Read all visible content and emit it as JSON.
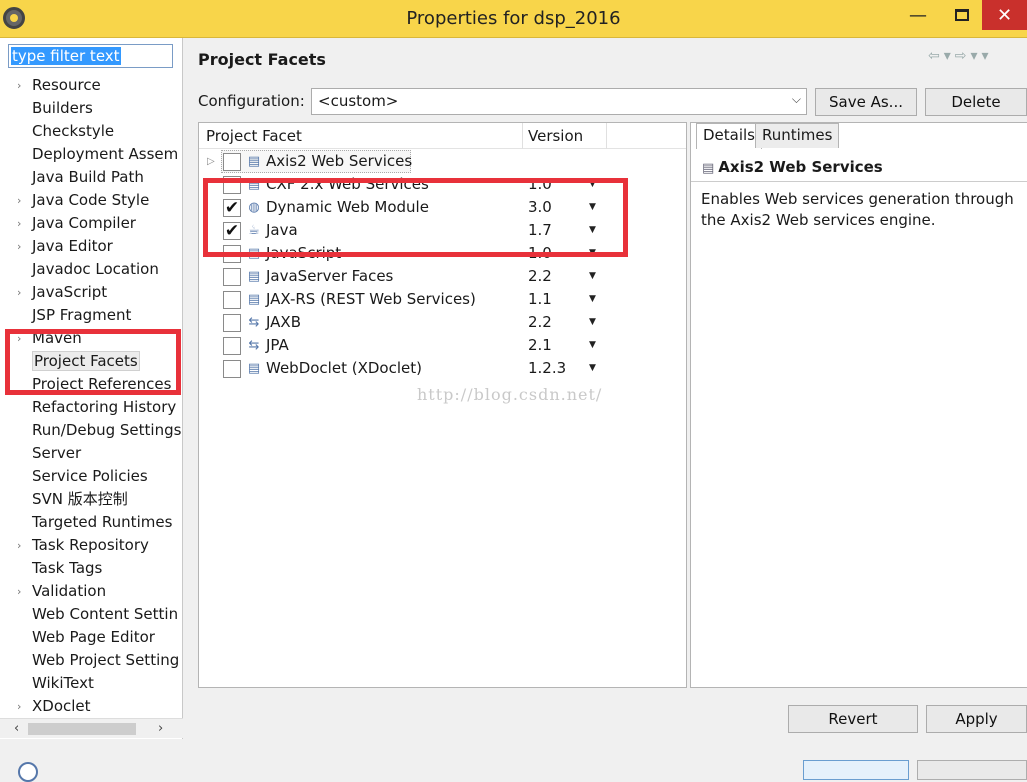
{
  "window": {
    "title": "Properties for dsp_2016"
  },
  "filter": {
    "value": "type filter text"
  },
  "nav_items": [
    {
      "label": "Resource",
      "expandable": true
    },
    {
      "label": "Builders",
      "expandable": false
    },
    {
      "label": "Checkstyle",
      "expandable": false
    },
    {
      "label": "Deployment Assem",
      "expandable": false
    },
    {
      "label": "Java Build Path",
      "expandable": false
    },
    {
      "label": "Java Code Style",
      "expandable": true
    },
    {
      "label": "Java Compiler",
      "expandable": true
    },
    {
      "label": "Java Editor",
      "expandable": true
    },
    {
      "label": "Javadoc Location",
      "expandable": false
    },
    {
      "label": "JavaScript",
      "expandable": true
    },
    {
      "label": "JSP Fragment",
      "expandable": false
    },
    {
      "label": "Maven",
      "expandable": true
    },
    {
      "label": "Project Facets",
      "expandable": false,
      "selected": true
    },
    {
      "label": "Project References",
      "expandable": false
    },
    {
      "label": "Refactoring History",
      "expandable": false
    },
    {
      "label": "Run/Debug Settings",
      "expandable": false
    },
    {
      "label": "Server",
      "expandable": false
    },
    {
      "label": "Service Policies",
      "expandable": false
    },
    {
      "label": "SVN 版本控制",
      "expandable": false
    },
    {
      "label": "Targeted Runtimes",
      "expandable": false
    },
    {
      "label": "Task Repository",
      "expandable": true
    },
    {
      "label": "Task Tags",
      "expandable": false
    },
    {
      "label": "Validation",
      "expandable": true
    },
    {
      "label": "Web Content Settin",
      "expandable": false
    },
    {
      "label": "Web Page Editor",
      "expandable": false
    },
    {
      "label": "Web Project Setting",
      "expandable": false
    },
    {
      "label": "WikiText",
      "expandable": false
    },
    {
      "label": "XDoclet",
      "expandable": true
    }
  ],
  "page": {
    "title": "Project Facets"
  },
  "config": {
    "label": "Configuration:",
    "value": "<custom>",
    "save_as": "Save As...",
    "delete": "Delete"
  },
  "facet_table": {
    "col_facet": "Project Facet",
    "col_version": "Version",
    "rows": [
      {
        "name": "Axis2 Web Services",
        "version": "",
        "checked": false,
        "expandable": true,
        "icon": "doc-icon",
        "highlighted": true
      },
      {
        "name": "CXF 2.x Web Services",
        "version": "1.0",
        "checked": false,
        "icon": "doc-icon"
      },
      {
        "name": "Dynamic Web Module",
        "version": "3.0",
        "checked": true,
        "icon": "web-module-icon"
      },
      {
        "name": "Java",
        "version": "1.7",
        "checked": true,
        "icon": "java-icon"
      },
      {
        "name": "JavaScript",
        "version": "1.0",
        "checked": false,
        "icon": "doc-icon"
      },
      {
        "name": "JavaServer Faces",
        "version": "2.2",
        "checked": false,
        "icon": "doc-icon"
      },
      {
        "name": "JAX-RS (REST Web Services)",
        "version": "1.1",
        "checked": false,
        "icon": "doc-icon"
      },
      {
        "name": "JAXB",
        "version": "2.2",
        "checked": false,
        "icon": "arrows-icon"
      },
      {
        "name": "JPA",
        "version": "2.1",
        "checked": false,
        "icon": "arrows-icon"
      },
      {
        "name": "WebDoclet (XDoclet)",
        "version": "1.2.3",
        "checked": false,
        "icon": "doc-icon"
      }
    ]
  },
  "watermark": "http://blog.csdn.net/",
  "details": {
    "tab_details": "Details",
    "tab_runtimes": "Runtimes",
    "title": "Axis2 Web Services",
    "description": "Enables Web services generation through the Axis2 Web services engine."
  },
  "buttons": {
    "revert": "Revert",
    "apply": "Apply"
  },
  "colors": {
    "titlebar": "#f8d54a",
    "close": "#c9302c",
    "highlight_box": "#e8313a"
  }
}
